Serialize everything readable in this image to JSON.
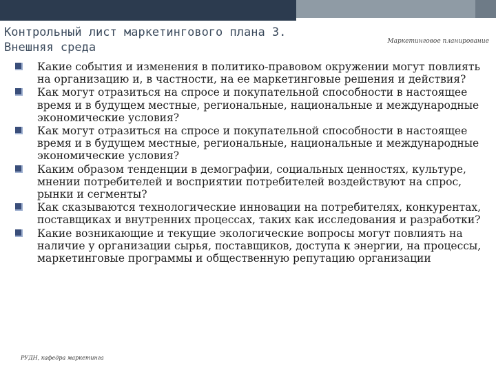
{
  "slide": {
    "title_line1": "Контрольный лист маркетингового плана 3.",
    "title_line2": "Внешняя среда",
    "header_right": "Маркетинговое планирование",
    "footer": "РУДН, кафедра маркетинга",
    "colors": {
      "band_dark": "#2c3b4f",
      "band_light": "#8f9ba5",
      "bullet": "#3a4e7a"
    },
    "bullet_icon": "square-bullet-icon",
    "items": [
      {
        "text": "Какие события и изменения в политико-правовом окружении могут повлиять на организацию и, в частности, на ее маркетинговые решения и действия?"
      },
      {
        "text": "Как могут отразиться на спросе и покупательной способности в настоящее время и в будущем местные, региональные, национальные и международные экономические условия?"
      },
      {
        "text": "Как могут отразиться на спросе и покупательной способности в настоящее время и в будущем местные, региональные, национальные и международные экономические условия?"
      },
      {
        "text": "Каким образом тенденции в демографии, социальных ценностях, культуре, мнении потребителей и восприятии потребителей воздействуют на спрос, рынки и сегменты?"
      },
      {
        "text": "Как сказываются технологические инновации на потребителях, конкурентах, поставщиках и внутренних процессах, таких как исследования и разработки?"
      },
      {
        "text": "Какие возникающие и текущие экологические вопросы могут повлиять на наличие у организации сырья, поставщиков, доступа к энергии, на процессы, маркетинговые программы и общественную репутацию организации"
      }
    ]
  }
}
